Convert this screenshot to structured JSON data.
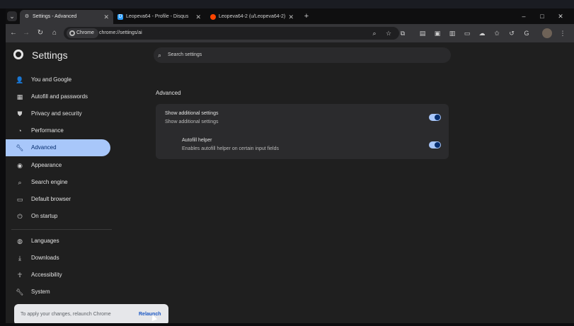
{
  "colors": {
    "accent": "#a8c7fa",
    "accent_dark": "#062e6f",
    "tab_active": "#353538",
    "bg": "#1f1f1f"
  },
  "tabs": [
    {
      "label": "Settings - Advanced",
      "icon": "gear-icon",
      "active": true
    },
    {
      "label": "Leopeva64 - Profile - Disqus",
      "icon": "disqus-icon"
    },
    {
      "label": "Leopeva64-2 (u/Leopeva64-2)",
      "icon": "reddit-icon"
    }
  ],
  "window_controls": {
    "minimize": "–",
    "maximize": "□",
    "close": "✕"
  },
  "toolbar": {
    "site_chip": "Chrome",
    "url": "chrome://settings/ai"
  },
  "settings": {
    "title": "Settings",
    "search_placeholder": "Search settings",
    "nav": [
      {
        "label": "You and Google",
        "icon": "person-icon"
      },
      {
        "label": "Autofill and passwords",
        "icon": "clipboard-icon"
      },
      {
        "label": "Privacy and security",
        "icon": "shield-icon"
      },
      {
        "label": "Performance",
        "icon": "gauge-icon"
      },
      {
        "label": "Advanced",
        "icon": "wrench-icon",
        "active": true
      },
      {
        "label": "Appearance",
        "icon": "palette-icon"
      },
      {
        "label": "Search engine",
        "icon": "search-icon"
      },
      {
        "label": "Default browser",
        "icon": "browser-icon"
      },
      {
        "label": "On startup",
        "icon": "power-icon"
      },
      {
        "label": "Languages",
        "icon": "globe-icon"
      },
      {
        "label": "Downloads",
        "icon": "download-icon"
      },
      {
        "label": "Accessibility",
        "icon": "accessibility-icon"
      },
      {
        "label": "System",
        "icon": "wrench-icon"
      }
    ],
    "section_title": "Advanced",
    "rows": [
      {
        "title": "Show additional settings",
        "subtitle": "Show additional settings",
        "enabled": true
      },
      {
        "title": "Autofill helper",
        "subtitle": "Enables autofill helper on certain input fields",
        "enabled": true
      }
    ]
  },
  "toast": {
    "message": "To apply your changes, relaunch Chrome",
    "button": "Relaunch"
  }
}
